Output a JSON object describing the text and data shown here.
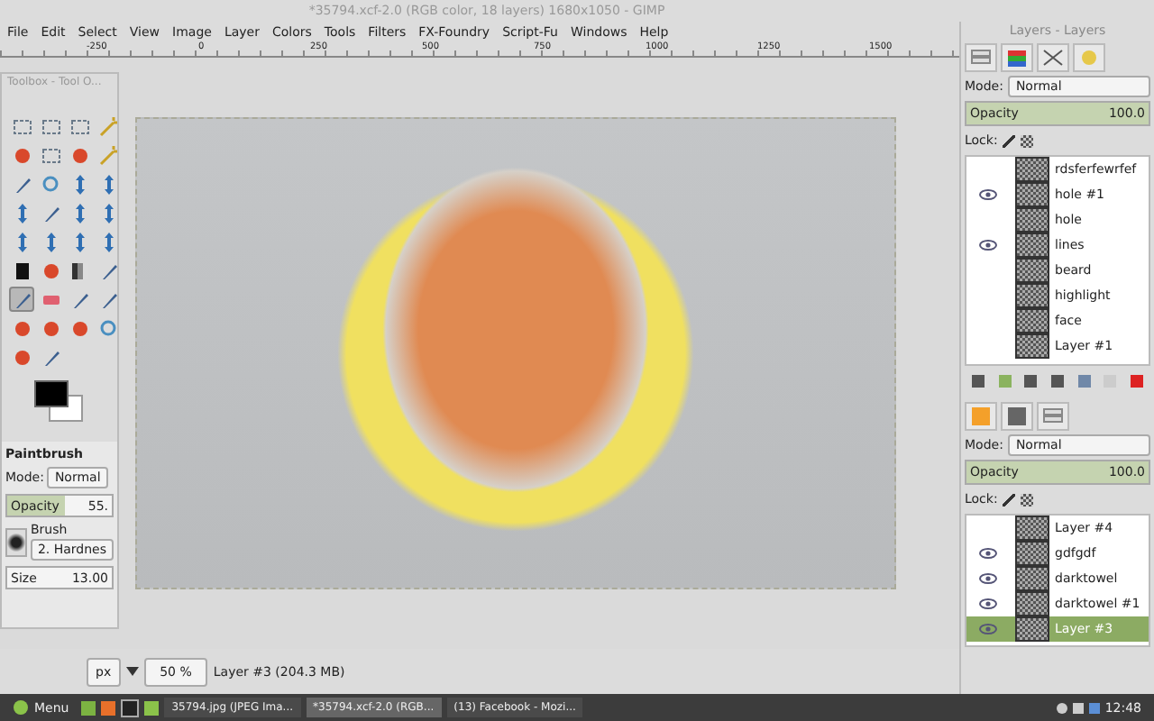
{
  "window": {
    "title": "*35794.xcf-2.0 (RGB color, 18 layers) 1680x1050 - GIMP"
  },
  "menu": [
    "File",
    "Edit",
    "Select",
    "View",
    "Image",
    "Layer",
    "Colors",
    "Tools",
    "Filters",
    "FX-Foundry",
    "Script-Fu",
    "Windows",
    "Help"
  ],
  "ruler": [
    "-250",
    "0",
    "250",
    "500",
    "750",
    "1000",
    "1250",
    "1500"
  ],
  "toolbox": {
    "title": "Toolbox - Tool O...",
    "tools": [
      {
        "kind": "select",
        "selected": false
      },
      {
        "kind": "select",
        "selected": false
      },
      {
        "kind": "select",
        "selected": false
      },
      {
        "kind": "wand",
        "selected": false
      },
      {
        "kind": "color",
        "selected": false
      },
      {
        "kind": "select",
        "selected": false
      },
      {
        "kind": "color",
        "selected": false
      },
      {
        "kind": "wand",
        "selected": false
      },
      {
        "kind": "paint",
        "selected": false
      },
      {
        "kind": "zoom",
        "selected": false
      },
      {
        "kind": "transform",
        "selected": false
      },
      {
        "kind": "transform",
        "selected": false
      },
      {
        "kind": "transform",
        "selected": false
      },
      {
        "kind": "paint",
        "selected": false
      },
      {
        "kind": "transform",
        "selected": false
      },
      {
        "kind": "transform",
        "selected": false
      },
      {
        "kind": "transform",
        "selected": false
      },
      {
        "kind": "transform",
        "selected": false
      },
      {
        "kind": "transform",
        "selected": false
      },
      {
        "kind": "transform",
        "selected": false
      },
      {
        "kind": "text",
        "selected": false
      },
      {
        "kind": "color",
        "selected": false
      },
      {
        "kind": "blend",
        "selected": false
      },
      {
        "kind": "paint",
        "selected": false
      },
      {
        "kind": "paint",
        "selected": true
      },
      {
        "kind": "eraser",
        "selected": false
      },
      {
        "kind": "paint",
        "selected": false
      },
      {
        "kind": "paint",
        "selected": false
      },
      {
        "kind": "color",
        "selected": false
      },
      {
        "kind": "color",
        "selected": false
      },
      {
        "kind": "color",
        "selected": false
      },
      {
        "kind": "zoom",
        "selected": false
      },
      {
        "kind": "color",
        "selected": false
      },
      {
        "kind": "paint",
        "selected": false
      }
    ],
    "options": {
      "tool": "Paintbrush",
      "mode_label": "Mode:",
      "mode": "Normal",
      "opacity_label": "Opacity",
      "opacity": "55.",
      "level": 0.55,
      "brush_label": "Brush",
      "brush": "2. Hardnes",
      "size_label": "Size",
      "size": "13.00"
    }
  },
  "layers_dock": {
    "title": "Layers - Layers",
    "mode_label": "Mode:",
    "mode": "Normal",
    "opacity_label": "Opacity",
    "opacity": "100.0",
    "level": 1.0,
    "lock_label": "Lock:",
    "layers": [
      {
        "name": "rdsferfewrfef",
        "visible": false,
        "selected": false
      },
      {
        "name": "hole #1",
        "visible": true,
        "selected": false
      },
      {
        "name": "hole",
        "visible": false,
        "selected": false
      },
      {
        "name": "lines",
        "visible": true,
        "selected": false
      },
      {
        "name": "beard",
        "visible": false,
        "selected": false
      },
      {
        "name": "highlight",
        "visible": false,
        "selected": false
      },
      {
        "name": "face",
        "visible": false,
        "selected": false
      },
      {
        "name": "Layer #1",
        "visible": false,
        "selected": false
      }
    ]
  },
  "layers_dock_2": {
    "mode_label": "Mode:",
    "mode": "Normal",
    "opacity_label": "Opacity",
    "opacity": "100.0",
    "level": 1.0,
    "lock_label": "Lock:",
    "layers": [
      {
        "name": "Layer #4",
        "visible": false,
        "selected": false
      },
      {
        "name": "gdfgdf",
        "visible": true,
        "selected": false
      },
      {
        "name": "darktowel",
        "visible": true,
        "selected": false
      },
      {
        "name": "darktowel #1",
        "visible": true,
        "selected": false
      },
      {
        "name": "Layer #3",
        "visible": true,
        "selected": true
      }
    ]
  },
  "status_bar": {
    "unit": "px",
    "zoom": "50 %",
    "info": "Layer #3 (204.3 MB)"
  },
  "taskbar": {
    "menu": "Menu",
    "tasks": [
      {
        "label": "35794.jpg (JPEG Ima...",
        "selected": false
      },
      {
        "label": "*35794.xcf-2.0 (RGB...",
        "selected": true
      },
      {
        "label": "(13) Facebook - Mozi...",
        "selected": false
      }
    ],
    "clock": "12:48"
  }
}
